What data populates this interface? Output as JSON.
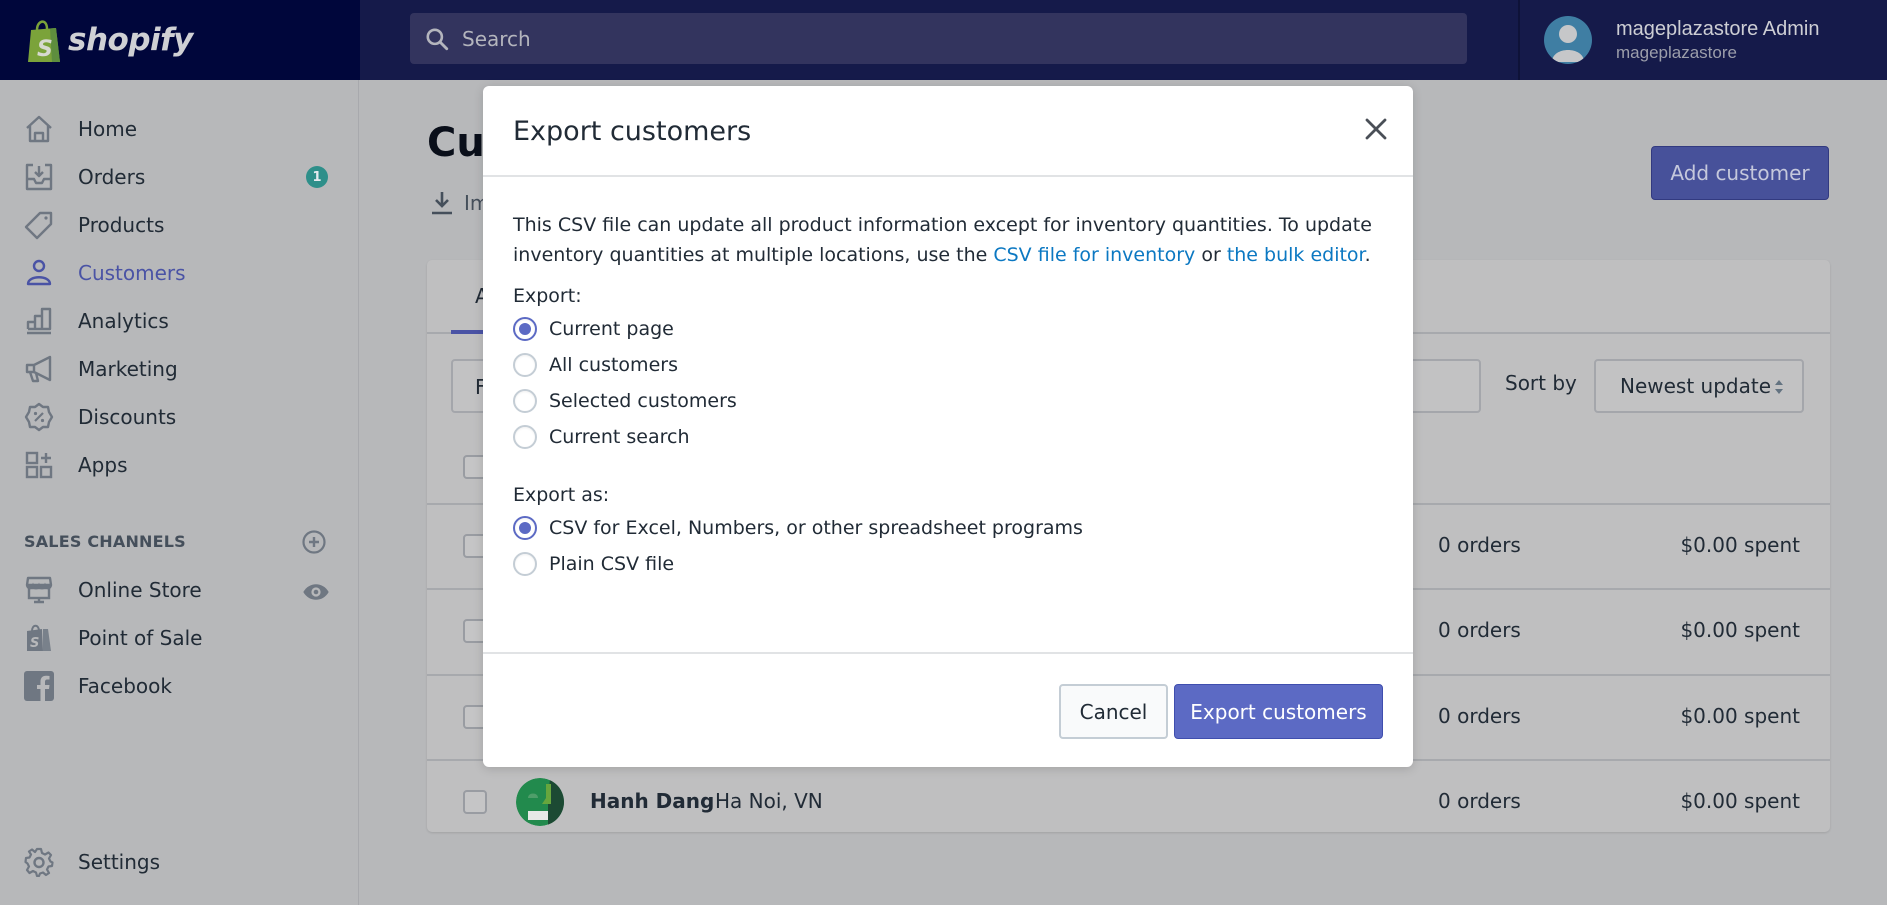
{
  "topbar": {
    "brand": "shopify",
    "search_placeholder": "Search",
    "user_name": "mageplazastore Admin",
    "store_name": "mageplazastore"
  },
  "sidebar": {
    "items": [
      {
        "label": "Home",
        "icon": "home-icon"
      },
      {
        "label": "Orders",
        "icon": "orders-icon",
        "badge": "1"
      },
      {
        "label": "Products",
        "icon": "tag-icon"
      },
      {
        "label": "Customers",
        "icon": "customer-icon",
        "active": true
      },
      {
        "label": "Analytics",
        "icon": "analytics-icon"
      },
      {
        "label": "Marketing",
        "icon": "megaphone-icon"
      },
      {
        "label": "Discounts",
        "icon": "discount-icon"
      },
      {
        "label": "Apps",
        "icon": "apps-icon"
      }
    ],
    "sales_channels_title": "SALES CHANNELS",
    "channels": [
      {
        "label": "Online Store",
        "icon": "store-icon"
      },
      {
        "label": "Point of Sale",
        "icon": "pos-icon"
      },
      {
        "label": "Facebook",
        "icon": "facebook-icon"
      }
    ],
    "settings_label": "Settings"
  },
  "main": {
    "page_title": "Customers",
    "import_label": "Import",
    "add_customer_label": "Add customer",
    "tab_active": "All",
    "filter_placeholder": "Filter customers",
    "sort_label": "Sort by",
    "sort_value": "Newest update",
    "rows": [
      {
        "name": "",
        "location": "",
        "orders": "0 orders",
        "spent": "$0.00 spent"
      },
      {
        "name": "",
        "location": "",
        "orders": "0 orders",
        "spent": "$0.00 spent"
      },
      {
        "name": "",
        "location": "",
        "orders": "0 orders",
        "spent": "$0.00 spent"
      },
      {
        "name": "Hanh Dang",
        "location": "Ha Noi, VN",
        "orders": "0 orders",
        "spent": "$0.00 spent"
      }
    ]
  },
  "modal": {
    "title": "Export customers",
    "description_prefix": "This CSV file can update all product information except for inventory quantities. To update inventory quantities at multiple locations, use the ",
    "link1": "CSV file for inventory",
    "middle": " or ",
    "link2": "the bulk editor",
    "suffix": ".",
    "export_label": "Export:",
    "export_options": [
      {
        "label": "Current page",
        "checked": true
      },
      {
        "label": "All customers",
        "checked": false
      },
      {
        "label": "Selected customers",
        "checked": false
      },
      {
        "label": "Current search",
        "checked": false
      }
    ],
    "export_as_label": "Export as:",
    "export_as_options": [
      {
        "label": "CSV for Excel, Numbers, or other spreadsheet programs",
        "checked": true
      },
      {
        "label": "Plain CSV file",
        "checked": false
      }
    ],
    "cancel_label": "Cancel",
    "submit_label": "Export customers"
  },
  "colors": {
    "topbar": "#00063b",
    "accent": "#5c6ac4",
    "link": "#0b78c2",
    "badge": "#2e8f8a"
  }
}
